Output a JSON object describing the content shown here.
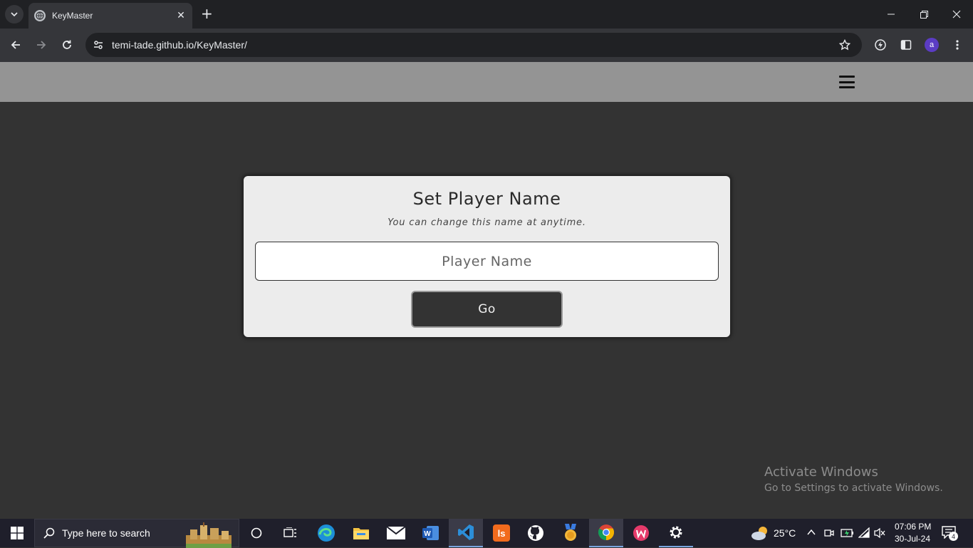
{
  "browser": {
    "tab_title": "KeyMaster",
    "url": "temi-tade.github.io/KeyMaster/",
    "profile_initial": "a"
  },
  "page": {
    "dialog": {
      "title": "Set Player Name",
      "hint": "You can change this name at anytime.",
      "input_placeholder": "Player Name",
      "input_value": "",
      "go_label": "Go"
    }
  },
  "watermark": {
    "line1": "Activate Windows",
    "line2": "Go to Settings to activate Windows."
  },
  "taskbar": {
    "search_placeholder": "Type here to search",
    "weather": "25°C",
    "time": "07:06 PM",
    "date": "30-Jul-24",
    "notification_count": "4",
    "apps": [
      "cortana-icon",
      "task-view-icon",
      "edge-icon",
      "file-explorer-icon",
      "mail-icon",
      "word-icon",
      "vscode-icon",
      "livestorm-icon",
      "github-icon",
      "medal-icon",
      "chrome-icon",
      "wps-icon",
      "settings-icon"
    ]
  },
  "colors": {
    "page_bg": "#333333",
    "header_bg": "#949494",
    "card_bg": "#ececec",
    "button_bg": "#333333"
  }
}
